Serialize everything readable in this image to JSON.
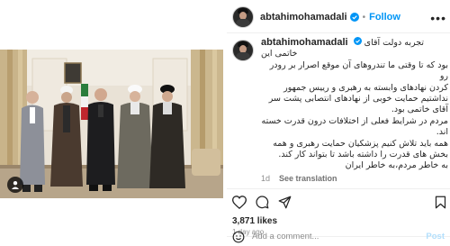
{
  "post": {
    "username": "abtahimohamadali",
    "follow_label": "Follow",
    "more_label": "•••",
    "caption_lines": [
      "تجربه دولت آقای خاتمی این",
      "بود که تا وقتی ما تندروهای آن موقع اصرار بر رودر رو",
      "کردن نهادهای وابسته به رهبری و رییس جمهور",
      "نداشتیم حمایت خوبی از نهادهای انتصابی پشت سر",
      "آقای خاتمی بود.",
      "مردم در شرایط فعلی از اختلافات درون قدرت خسته",
      "اند.",
      "همه باید تلاش کنیم پزشکیان حمایت رهبری و همه",
      "بخش های قدرت را داشته باشد تا بتواند کار کند.",
      "به خاطر مردم،به خاطر ایران"
    ],
    "caption_age": "1d",
    "see_translation": "See translation",
    "likes": "3,871 likes",
    "posted_ago": "1 day ago",
    "comment_placeholder": "Add a comment...",
    "post_button": "Post"
  },
  "colors": {
    "accent": "#0095f6",
    "verified": "#0095f6",
    "muted": "#8e8e8e",
    "text": "#262626"
  }
}
